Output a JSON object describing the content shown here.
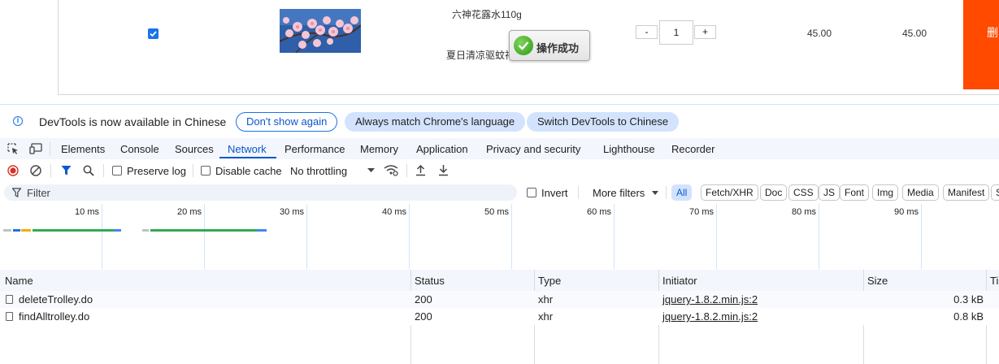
{
  "cart": {
    "product_name": "六神花露水110g",
    "product_desc": "夏日清凉驱蚊神",
    "toast_text": "操作成功",
    "quantity": "1",
    "minus_label": "-",
    "plus_label": "+",
    "unit_price": "45.00",
    "subtotal": "45.00",
    "delete_label": "删除",
    "checkbox_checked": true,
    "accent_color": "#ff4a00"
  },
  "devtools": {
    "infobar": {
      "icon": "info-icon",
      "message": "DevTools is now available in Chinese",
      "dont_show": "Don't show again",
      "match_language": "Always match Chrome's language",
      "switch_chinese": "Switch DevTools to Chinese"
    },
    "tabs": [
      "Elements",
      "Console",
      "Sources",
      "Network",
      "Performance",
      "Memory",
      "Application",
      "Privacy and security",
      "Lighthouse",
      "Recorder"
    ],
    "active_tab": "Network",
    "toolbar": {
      "preserve_log": "Preserve log",
      "disable_cache": "Disable cache",
      "throttling": "No throttling"
    },
    "filter": {
      "placeholder": "Filter",
      "invert": "Invert",
      "more_filters": "More filters",
      "types": [
        "All",
        "Fetch/XHR",
        "Doc",
        "CSS",
        "JS",
        "Font",
        "Img",
        "Media",
        "Manifest",
        "S"
      ]
    },
    "timeline": {
      "ticks": [
        "10 ms",
        "20 ms",
        "30 ms",
        "40 ms",
        "50 ms",
        "60 ms",
        "70 ms",
        "80 ms",
        "90 ms"
      ]
    },
    "table": {
      "columns": [
        "Name",
        "Status",
        "Type",
        "Initiator",
        "Size",
        "Ti"
      ],
      "rows": [
        {
          "name": "deleteTrolley.do",
          "status": "200",
          "type": "xhr",
          "initiator": "jquery-1.8.2.min.js:2",
          "size": "0.3 kB"
        },
        {
          "name": "findAlltrolley.do",
          "status": "200",
          "type": "xhr",
          "initiator": "jquery-1.8.2.min.js:2",
          "size": "0.8 kB"
        }
      ]
    }
  }
}
